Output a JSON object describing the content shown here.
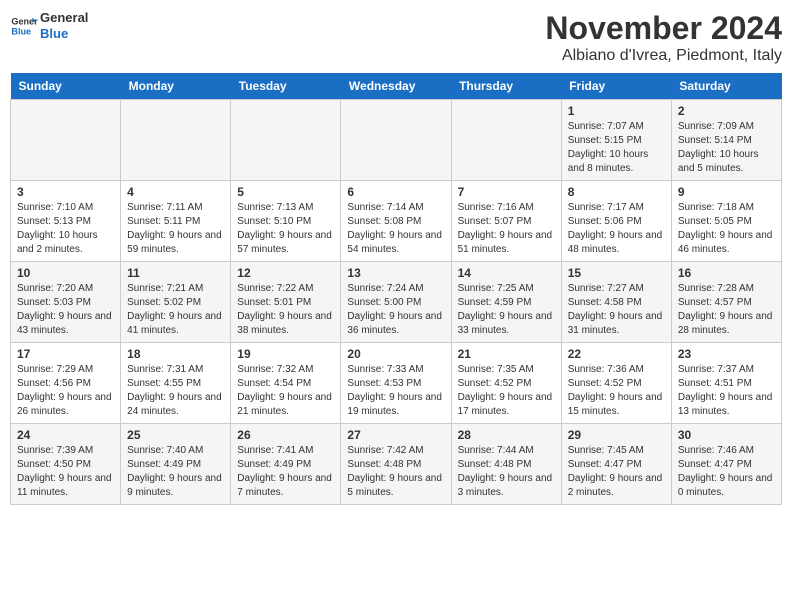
{
  "header": {
    "logo_line1": "General",
    "logo_line2": "Blue",
    "title": "November 2024",
    "subtitle": "Albiano d'Ivrea, Piedmont, Italy"
  },
  "calendar": {
    "days_of_week": [
      "Sunday",
      "Monday",
      "Tuesday",
      "Wednesday",
      "Thursday",
      "Friday",
      "Saturday"
    ],
    "weeks": [
      [
        {
          "day": "",
          "data": ""
        },
        {
          "day": "",
          "data": ""
        },
        {
          "day": "",
          "data": ""
        },
        {
          "day": "",
          "data": ""
        },
        {
          "day": "",
          "data": ""
        },
        {
          "day": "1",
          "data": "Sunrise: 7:07 AM\nSunset: 5:15 PM\nDaylight: 10 hours and 8 minutes."
        },
        {
          "day": "2",
          "data": "Sunrise: 7:09 AM\nSunset: 5:14 PM\nDaylight: 10 hours and 5 minutes."
        }
      ],
      [
        {
          "day": "3",
          "data": "Sunrise: 7:10 AM\nSunset: 5:13 PM\nDaylight: 10 hours and 2 minutes."
        },
        {
          "day": "4",
          "data": "Sunrise: 7:11 AM\nSunset: 5:11 PM\nDaylight: 9 hours and 59 minutes."
        },
        {
          "day": "5",
          "data": "Sunrise: 7:13 AM\nSunset: 5:10 PM\nDaylight: 9 hours and 57 minutes."
        },
        {
          "day": "6",
          "data": "Sunrise: 7:14 AM\nSunset: 5:08 PM\nDaylight: 9 hours and 54 minutes."
        },
        {
          "day": "7",
          "data": "Sunrise: 7:16 AM\nSunset: 5:07 PM\nDaylight: 9 hours and 51 minutes."
        },
        {
          "day": "8",
          "data": "Sunrise: 7:17 AM\nSunset: 5:06 PM\nDaylight: 9 hours and 48 minutes."
        },
        {
          "day": "9",
          "data": "Sunrise: 7:18 AM\nSunset: 5:05 PM\nDaylight: 9 hours and 46 minutes."
        }
      ],
      [
        {
          "day": "10",
          "data": "Sunrise: 7:20 AM\nSunset: 5:03 PM\nDaylight: 9 hours and 43 minutes."
        },
        {
          "day": "11",
          "data": "Sunrise: 7:21 AM\nSunset: 5:02 PM\nDaylight: 9 hours and 41 minutes."
        },
        {
          "day": "12",
          "data": "Sunrise: 7:22 AM\nSunset: 5:01 PM\nDaylight: 9 hours and 38 minutes."
        },
        {
          "day": "13",
          "data": "Sunrise: 7:24 AM\nSunset: 5:00 PM\nDaylight: 9 hours and 36 minutes."
        },
        {
          "day": "14",
          "data": "Sunrise: 7:25 AM\nSunset: 4:59 PM\nDaylight: 9 hours and 33 minutes."
        },
        {
          "day": "15",
          "data": "Sunrise: 7:27 AM\nSunset: 4:58 PM\nDaylight: 9 hours and 31 minutes."
        },
        {
          "day": "16",
          "data": "Sunrise: 7:28 AM\nSunset: 4:57 PM\nDaylight: 9 hours and 28 minutes."
        }
      ],
      [
        {
          "day": "17",
          "data": "Sunrise: 7:29 AM\nSunset: 4:56 PM\nDaylight: 9 hours and 26 minutes."
        },
        {
          "day": "18",
          "data": "Sunrise: 7:31 AM\nSunset: 4:55 PM\nDaylight: 9 hours and 24 minutes."
        },
        {
          "day": "19",
          "data": "Sunrise: 7:32 AM\nSunset: 4:54 PM\nDaylight: 9 hours and 21 minutes."
        },
        {
          "day": "20",
          "data": "Sunrise: 7:33 AM\nSunset: 4:53 PM\nDaylight: 9 hours and 19 minutes."
        },
        {
          "day": "21",
          "data": "Sunrise: 7:35 AM\nSunset: 4:52 PM\nDaylight: 9 hours and 17 minutes."
        },
        {
          "day": "22",
          "data": "Sunrise: 7:36 AM\nSunset: 4:52 PM\nDaylight: 9 hours and 15 minutes."
        },
        {
          "day": "23",
          "data": "Sunrise: 7:37 AM\nSunset: 4:51 PM\nDaylight: 9 hours and 13 minutes."
        }
      ],
      [
        {
          "day": "24",
          "data": "Sunrise: 7:39 AM\nSunset: 4:50 PM\nDaylight: 9 hours and 11 minutes."
        },
        {
          "day": "25",
          "data": "Sunrise: 7:40 AM\nSunset: 4:49 PM\nDaylight: 9 hours and 9 minutes."
        },
        {
          "day": "26",
          "data": "Sunrise: 7:41 AM\nSunset: 4:49 PM\nDaylight: 9 hours and 7 minutes."
        },
        {
          "day": "27",
          "data": "Sunrise: 7:42 AM\nSunset: 4:48 PM\nDaylight: 9 hours and 5 minutes."
        },
        {
          "day": "28",
          "data": "Sunrise: 7:44 AM\nSunset: 4:48 PM\nDaylight: 9 hours and 3 minutes."
        },
        {
          "day": "29",
          "data": "Sunrise: 7:45 AM\nSunset: 4:47 PM\nDaylight: 9 hours and 2 minutes."
        },
        {
          "day": "30",
          "data": "Sunrise: 7:46 AM\nSunset: 4:47 PM\nDaylight: 9 hours and 0 minutes."
        }
      ]
    ]
  }
}
